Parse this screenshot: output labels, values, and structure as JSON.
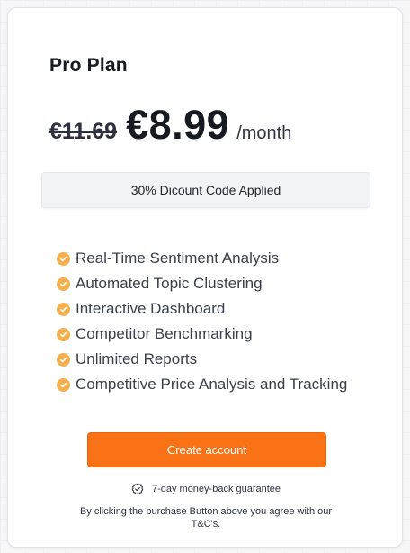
{
  "plan": {
    "title": "Pro Plan",
    "old_price": "€11.69",
    "new_price": "€8.99",
    "period": "/month"
  },
  "discount": {
    "label": "30% Dicount Code Applied"
  },
  "features": [
    "Real-Time Sentiment Analysis",
    "Automated Topic Clustering",
    "Interactive Dashboard",
    "Competitor Benchmarking",
    "Unlimited Reports",
    "Competitive Price Analysis and Tracking"
  ],
  "icons": {
    "feature": "check-circle-icon",
    "guarantee": "badge-check-icon"
  },
  "cta": {
    "label": "Create account"
  },
  "guarantee": {
    "text": "7-day money-back guarantee"
  },
  "terms": {
    "prefix": "By clicking the purchase Button above you agree with our ",
    "link": "T&C's",
    "suffix": "."
  },
  "colors": {
    "accent": "#f97316",
    "check": "#f3b04d",
    "text_dark": "#171a21"
  }
}
